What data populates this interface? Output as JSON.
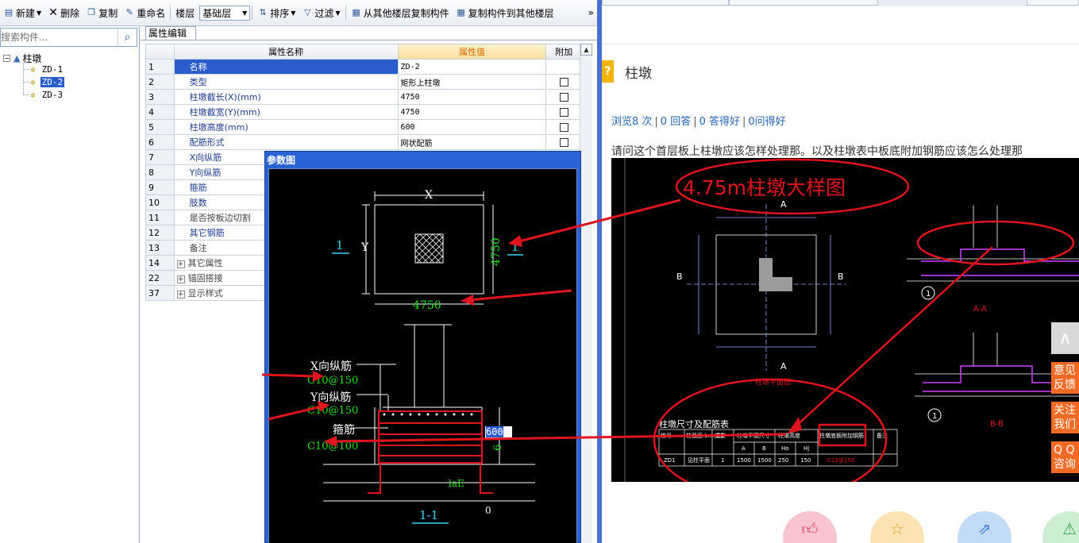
{
  "toolbar": {
    "new_label": "新建",
    "delete_label": "删除",
    "copy_label": "复制",
    "rename_label": "重命名",
    "floor_label": "楼层",
    "floor_value": "基础层",
    "sort_label": "排序",
    "filter_label": "过滤",
    "copy_from_floor_label": "从其他楼层复制构件",
    "copy_to_floor_label": "复制构件到其他楼层",
    "more_label": "»"
  },
  "tree": {
    "search_placeholder": "搜索构件...",
    "root_label": "柱墩",
    "root_toggle": "−",
    "items": [
      {
        "label": "ZD-1",
        "selected": false
      },
      {
        "label": "ZD-2",
        "selected": true
      },
      {
        "label": "ZD-3",
        "selected": false
      }
    ]
  },
  "property_panel": {
    "tab_label": "属性编辑",
    "columns": {
      "name": "属性名称",
      "value": "属性值",
      "extra": "附加"
    },
    "rows": [
      {
        "num": "1",
        "name": "名称",
        "value": "ZD-2",
        "checkbox": false,
        "selected": true
      },
      {
        "num": "2",
        "name": "类型",
        "value": "矩形上柱墩",
        "checkbox": true
      },
      {
        "num": "3",
        "name": "柱墩截长(X)(mm)",
        "value": "4750",
        "checkbox": true
      },
      {
        "num": "4",
        "name": "柱墩截宽(Y)(mm)",
        "value": "4750",
        "checkbox": true
      },
      {
        "num": "5",
        "name": "柱墩高度(mm)",
        "value": "600",
        "checkbox": true
      },
      {
        "num": "6",
        "name": "配筋形式",
        "value": "网状配筋",
        "checkbox": true
      },
      {
        "num": "7",
        "name": "X向纵筋",
        "value": "",
        "checkbox": false
      },
      {
        "num": "8",
        "name": "Y向纵筋",
        "value": "",
        "checkbox": false
      },
      {
        "num": "9",
        "name": "箍筋",
        "value": "",
        "checkbox": false
      },
      {
        "num": "10",
        "name": "肢数",
        "value": "",
        "checkbox": false
      },
      {
        "num": "11",
        "name": "是否按板边切割",
        "value": "",
        "checkbox": false,
        "gray": true
      },
      {
        "num": "12",
        "name": "其它钢筋",
        "value": "",
        "checkbox": false
      },
      {
        "num": "13",
        "name": "备注",
        "value": "",
        "checkbox": false,
        "gray": true
      },
      {
        "num": "14",
        "name": "其它属性",
        "value": "",
        "checkbox": false,
        "group": true
      },
      {
        "num": "22",
        "name": "锚固搭接",
        "value": "",
        "checkbox": false,
        "group": true
      },
      {
        "num": "37",
        "name": "显示样式",
        "value": "",
        "checkbox": false,
        "group": true
      }
    ]
  },
  "param_dialog": {
    "title": "参数图",
    "x_label": "X",
    "y_label": "Y",
    "section_mark": "1",
    "dim_width": "4750",
    "dim_height": "4750",
    "x_rebar_label": "X向纵筋",
    "x_rebar_value": "C10@150",
    "y_rebar_label": "Y向纵筋",
    "y_rebar_value": "C10@150",
    "stirrup_label": "箍筋",
    "stirrup_value": "C10@100",
    "height_input": "600",
    "height_dim": "6",
    "lae_label": "laE",
    "zero_label": "0",
    "section_title": "1-1"
  },
  "question": {
    "title_badge": "?",
    "title": "柱墩",
    "views": "浏览8 次",
    "answers": "0 回答",
    "good": "0 答得好",
    "got_good": "0问得好",
    "body": "请问这个首层板上柱墩应该怎样处理那。以及柱墩表中板底附加钢筋应该怎么处理那"
  },
  "drawing": {
    "annotation": "4.75m柱墩大样图",
    "section_a": "A",
    "section_b": "B",
    "section_aa": "A-A",
    "section_bb": "B-B",
    "plan_caption": "柱墩平面图",
    "marker_one": "1",
    "table_title": "柱墩尺寸及配筋表",
    "table_headers": [
      "编号",
      "柱截面 bxh或D",
      "类型",
      "柱墩平面尺寸",
      "",
      "柱墩高度",
      "",
      "柱墩底板附加钢筋",
      "备注"
    ],
    "table_subheaders": [
      "A",
      "B",
      "Ho",
      "Hj"
    ],
    "table_row": [
      "ZD1",
      "见柱平面",
      "1",
      "1500",
      "1500",
      "250",
      "150",
      "C12@150",
      ""
    ]
  },
  "float_bar": {
    "top_icon": "∧",
    "feedback": "意见\n反馈",
    "follow": "关注\n我们",
    "qq": "Q Q\n咨询"
  },
  "colors": {
    "accent_blue": "#2a5ccc",
    "cad_green": "#22e11c",
    "cad_cyan": "#3ad3f3",
    "annotation_red": "#e0141e",
    "float_orange": "#f36a24"
  }
}
